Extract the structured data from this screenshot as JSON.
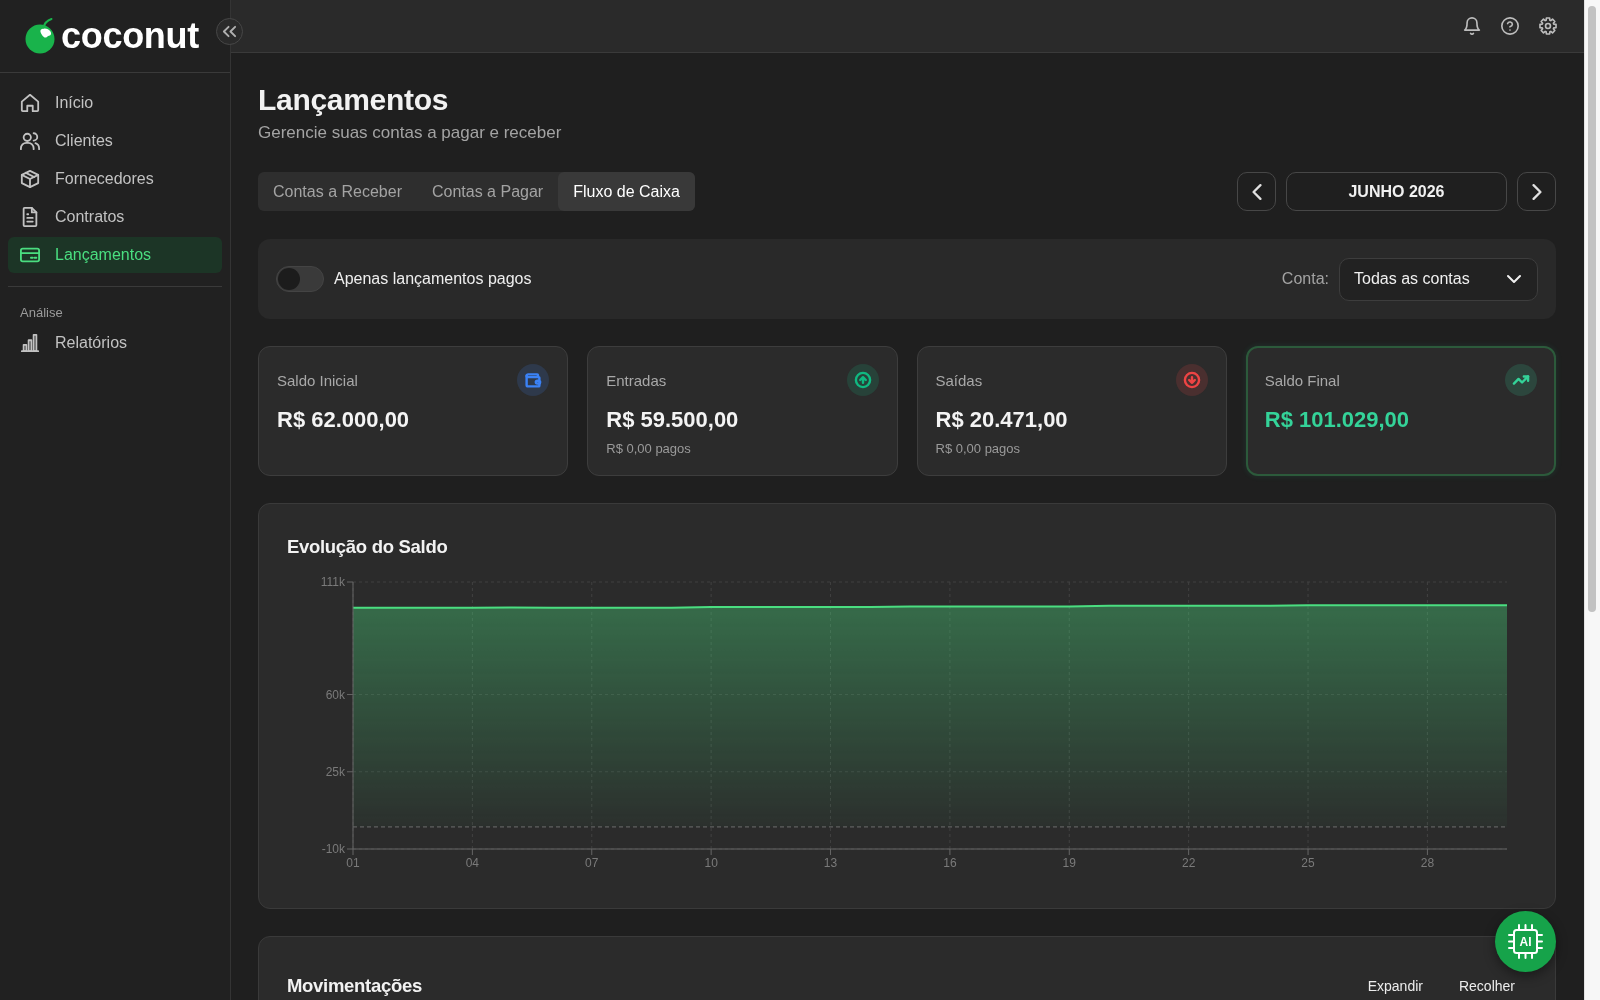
{
  "sidebar": {
    "logo": "coconut",
    "nav": [
      {
        "label": "Início",
        "selected": false
      },
      {
        "label": "Clientes",
        "selected": false
      },
      {
        "label": "Fornecedores",
        "selected": false
      },
      {
        "label": "Contratos",
        "selected": false
      },
      {
        "label": "Lançamentos",
        "selected": true
      }
    ],
    "sections": [
      {
        "title": "Análise",
        "items": [
          {
            "label": "Relatórios",
            "selected": false
          }
        ]
      }
    ]
  },
  "header": {
    "title": "Lançamentos",
    "subtitle": "Gerencie suas contas a pagar e receber"
  },
  "tabs": [
    {
      "label": "Contas a Receber",
      "selected": false
    },
    {
      "label": "Contas a Pagar",
      "selected": false
    },
    {
      "label": "Fluxo de Caixa",
      "selected": true
    }
  ],
  "period": {
    "label": "JUNHO 2026"
  },
  "filters": {
    "paid_only": {
      "label": "Apenas lançamentos pagos",
      "on": false
    },
    "account": {
      "label": "Conta:",
      "value": "Todas as contas"
    }
  },
  "summary_cards": [
    {
      "label": "Saldo Inicial",
      "value": "R$ 62.000,00",
      "color": "#3b82f6",
      "highlighted": false
    },
    {
      "label": "Entradas",
      "value": "R$ 59.500,00",
      "note": "R$ 0,00 pagos",
      "color": "#10b981",
      "highlighted": false
    },
    {
      "label": "Saídas",
      "value": "R$ 20.471,00",
      "note": "R$ 0,00 pagos",
      "color": "#ef4444",
      "highlighted": false
    },
    {
      "label": "Saldo Final",
      "value": "R$ 101.029,00",
      "color": "#34d399",
      "highlighted": true
    }
  ],
  "balance_chart": {
    "chart_data": {
      "type": "area",
      "title": "Evolução do Saldo",
      "x": [
        1,
        2,
        3,
        4,
        5,
        6,
        7,
        8,
        9,
        10,
        11,
        12,
        13,
        14,
        15,
        16,
        17,
        18,
        19,
        20,
        21,
        22,
        23,
        24,
        25,
        26,
        27,
        28,
        29,
        30
      ],
      "series": [
        {
          "color": "#4ade80",
          "values": [
            99300,
            99300,
            99300,
            99300,
            99400,
            99300,
            99300,
            99300,
            99300,
            99700,
            99700,
            99700,
            99700,
            99700,
            99900,
            99900,
            99900,
            99900,
            99900,
            100200,
            100200,
            100200,
            100200,
            100200,
            100500,
            100500,
            100500,
            100500,
            100500,
            100500
          ]
        }
      ],
      "xlim": [
        1,
        30
      ],
      "ylim": [
        -10000,
        111000
      ],
      "yticks": [
        {
          "value": -10000,
          "label": "-10k"
        },
        {
          "value": 25000,
          "label": "25k"
        },
        {
          "value": 60000,
          "label": "60k"
        },
        {
          "value": 111000,
          "label": "111k"
        }
      ],
      "xticks": [
        {
          "value": 1,
          "label": "01"
        },
        {
          "value": 4,
          "label": "04"
        },
        {
          "value": 7,
          "label": "07"
        },
        {
          "value": 10,
          "label": "10"
        },
        {
          "value": 13,
          "label": "13"
        },
        {
          "value": 16,
          "label": "16"
        },
        {
          "value": 19,
          "label": "19"
        },
        {
          "value": 22,
          "label": "22"
        },
        {
          "value": 25,
          "label": "25"
        },
        {
          "value": 28,
          "label": "28"
        }
      ],
      "grid": true,
      "ref_lines": [
        {
          "axis": "y",
          "value": 0
        }
      ]
    }
  },
  "movements": {
    "title": "Movimentações",
    "actions": [
      {
        "label": "Expandir"
      },
      {
        "label": "Recolher"
      }
    ]
  },
  "assistant_button": {
    "label": "AI"
  }
}
